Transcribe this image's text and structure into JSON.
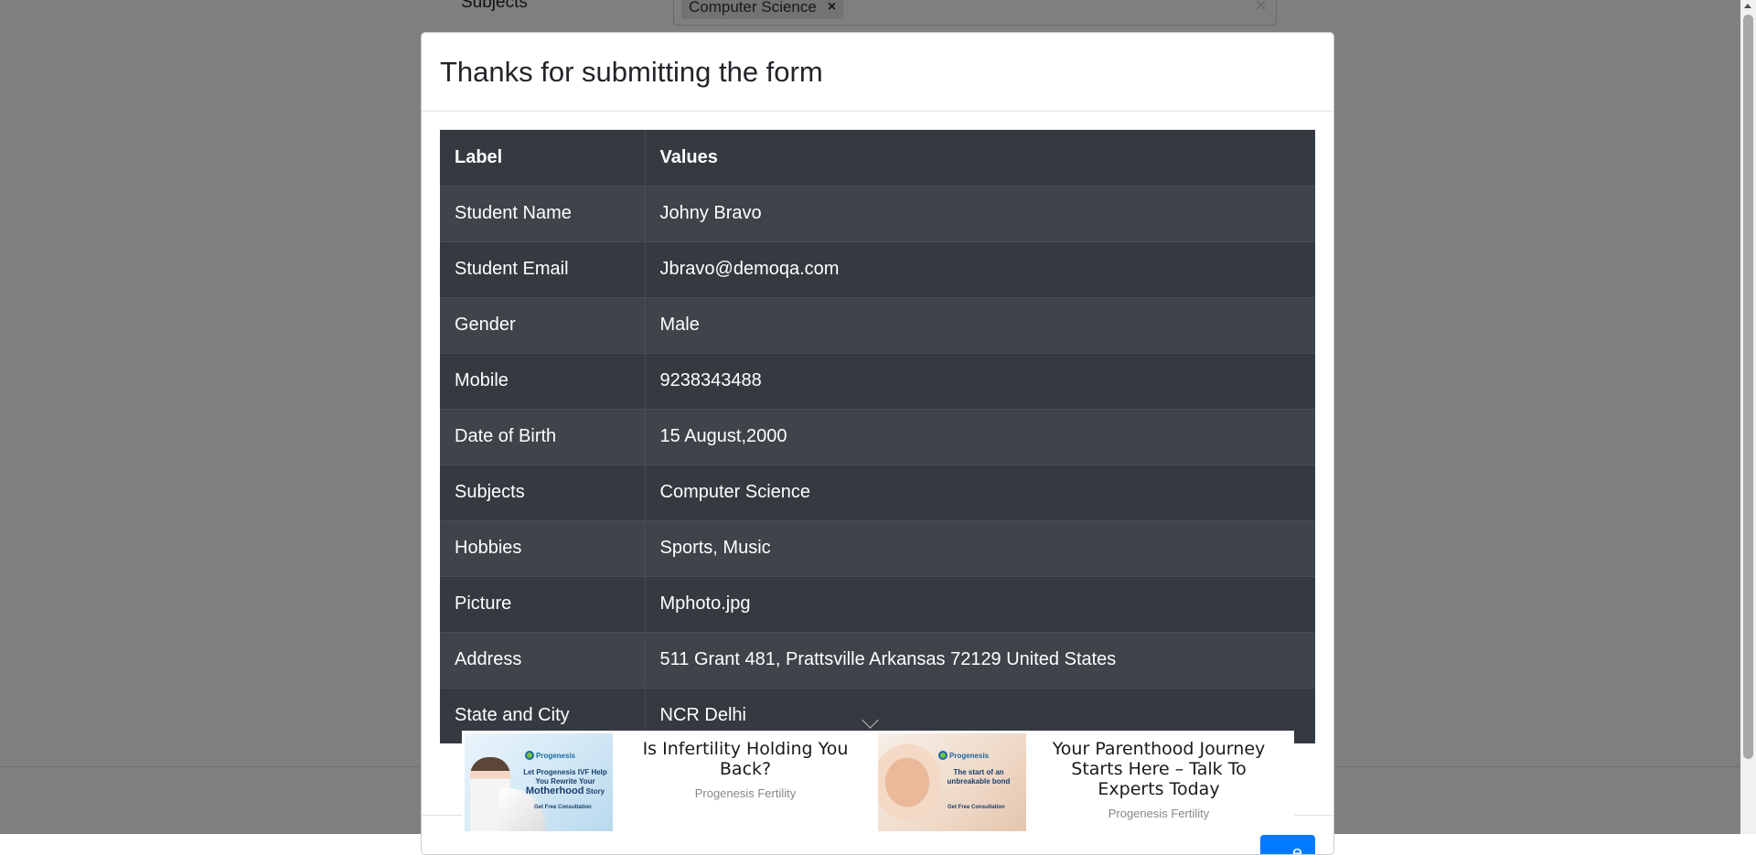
{
  "background": {
    "subjects_label": "Subjects",
    "subjects_chip": "Computer Science",
    "chip_remove_icon": "×",
    "clear_icon": "×"
  },
  "modal": {
    "title": "Thanks for submitting the form",
    "table": {
      "headers": [
        "Label",
        "Values"
      ],
      "rows": [
        {
          "label": "Student Name",
          "value": "Johny Bravo"
        },
        {
          "label": "Student Email",
          "value": "Jbravo@demoqa.com"
        },
        {
          "label": "Gender",
          "value": "Male"
        },
        {
          "label": "Mobile",
          "value": "9238343488"
        },
        {
          "label": "Date of Birth",
          "value": "15 August,2000"
        },
        {
          "label": "Subjects",
          "value": "Computer Science"
        },
        {
          "label": "Hobbies",
          "value": "Sports, Music"
        },
        {
          "label": "Picture",
          "value": "Mphoto.jpg"
        },
        {
          "label": "Address",
          "value": "511 Grant 481, Prattsville Arkansas 72129 United States"
        },
        {
          "label": "State and City",
          "value": "NCR Delhi"
        }
      ]
    },
    "close_button_label": "e"
  },
  "ad": {
    "units": [
      {
        "headline": "Is Infertility Holding You Back?",
        "source": "Progenesis Fertility",
        "image_logo": "Progenesis",
        "image_text": "Let Progenesis IVF Help You Rewrite Your",
        "image_text_big": "Motherhood",
        "image_text_end": "Story",
        "image_cta": "Get Free Consultation"
      },
      {
        "headline": "Your Parenthood Journey Starts Here – Talk To Experts Today",
        "source": "Progenesis Fertility",
        "image_logo": "Progenesis",
        "image_text": "The start of an unbreakable bond",
        "image_cta": "Get Free Consultation"
      }
    ]
  },
  "colors": {
    "table_bg": "#343a40",
    "primary": "#007bff",
    "backdrop": "rgba(0,0,0,0.5)"
  }
}
